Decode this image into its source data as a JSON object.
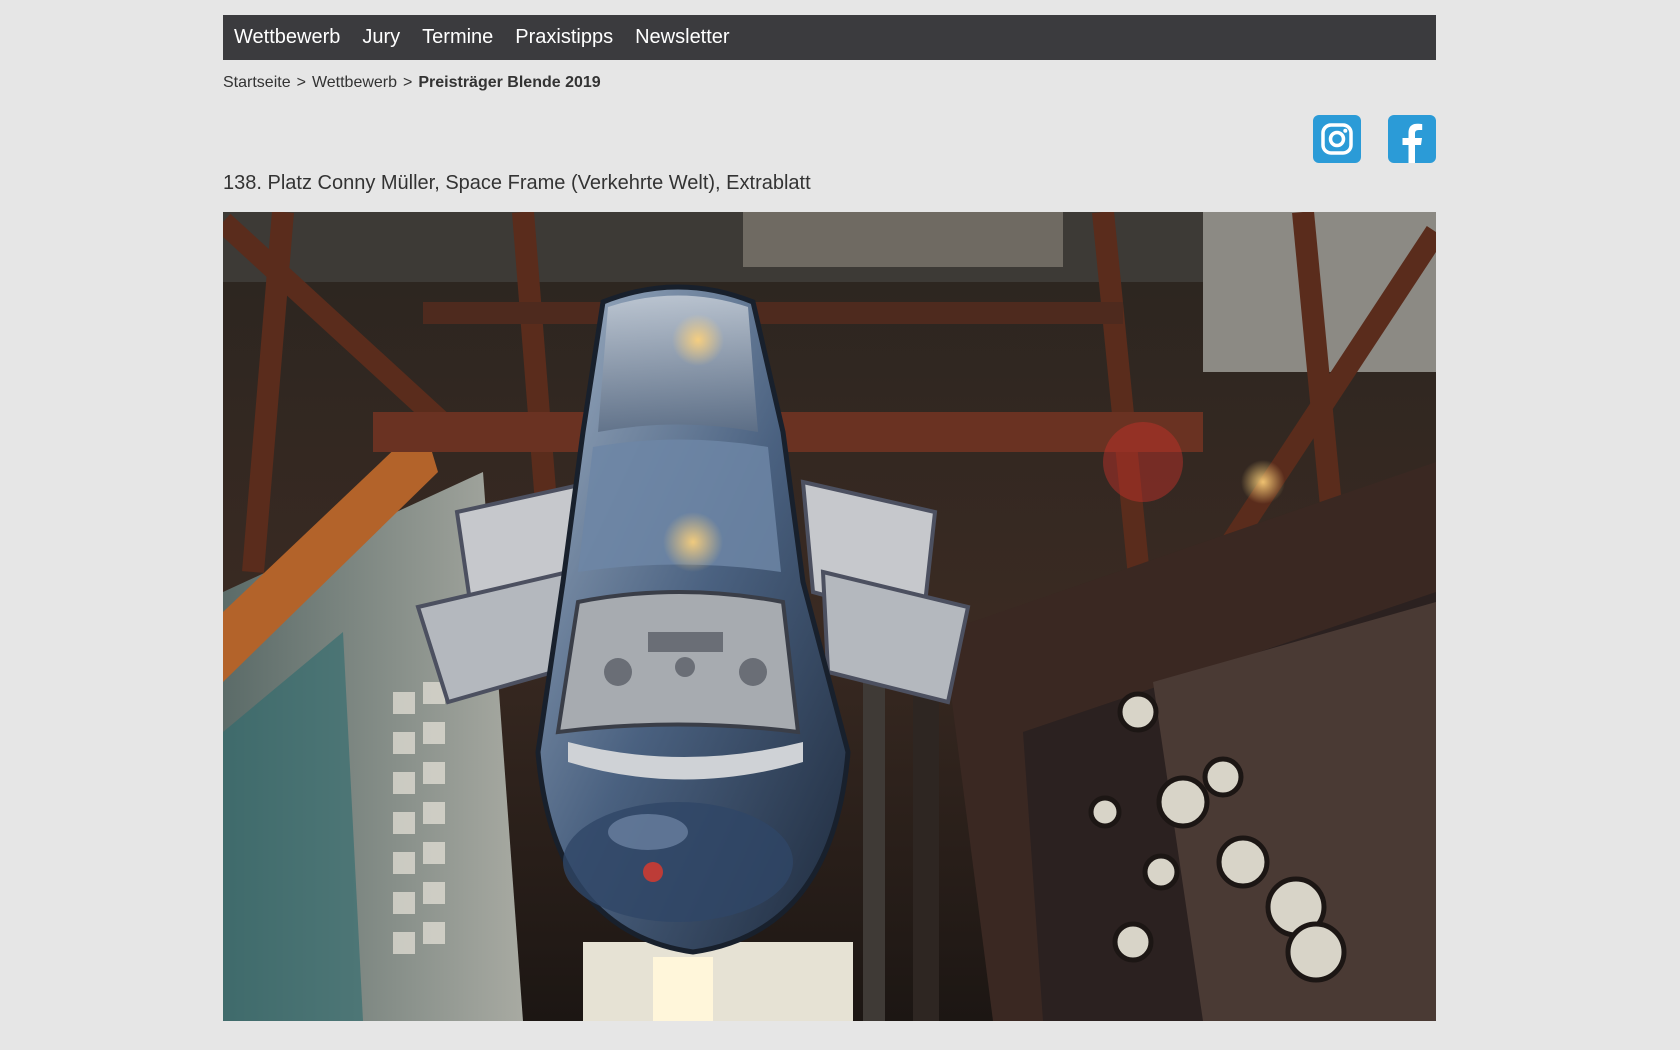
{
  "nav": {
    "items": [
      {
        "label": "Wettbewerb"
      },
      {
        "label": "Jury"
      },
      {
        "label": "Termine"
      },
      {
        "label": "Praxistipps"
      },
      {
        "label": "Newsletter"
      }
    ]
  },
  "breadcrumb": {
    "home": "Startseite",
    "separator": ">",
    "section": "Wettbewerb",
    "current": "Preisträger Blende 2019"
  },
  "social": {
    "instagram_icon": "instagram-icon",
    "facebook_icon": "facebook-icon",
    "color": "#2b9bd7"
  },
  "entry": {
    "caption": "138. Platz Conny Müller, Space Frame (Verkehrte Welt), Extrablatt"
  },
  "colors": {
    "background": "#e6e6e6",
    "nav_background": "#3b3b3e",
    "text": "#333333"
  }
}
